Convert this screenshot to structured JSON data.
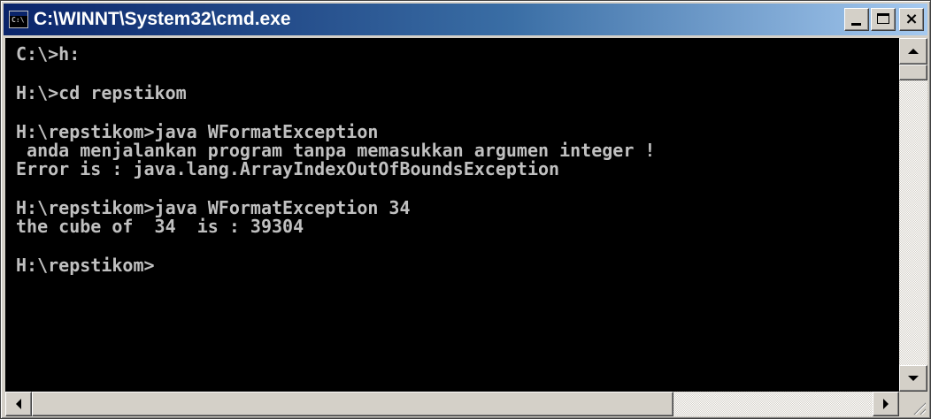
{
  "window": {
    "title": "C:\\WINNT\\System32\\cmd.exe"
  },
  "title_buttons": {
    "minimize": "minimize-icon",
    "maximize": "maximize-icon",
    "close": "×"
  },
  "console": {
    "background": "#000000",
    "foreground": "#c0c0c0",
    "lines": [
      "C:\\>h:",
      "",
      "H:\\>cd repstikom",
      "",
      "H:\\repstikom>java WFormatException",
      " anda menjalankan program tanpa memasukkan argumen integer !",
      "Error is : java.lang.ArrayIndexOutOfBoundsException",
      "",
      "H:\\repstikom>java WFormatException 34",
      "the cube of  34  is : 39304",
      "",
      "H:\\repstikom>"
    ]
  },
  "scrollbars": {
    "vertical_position": 0,
    "horizontal_position": 0
  }
}
